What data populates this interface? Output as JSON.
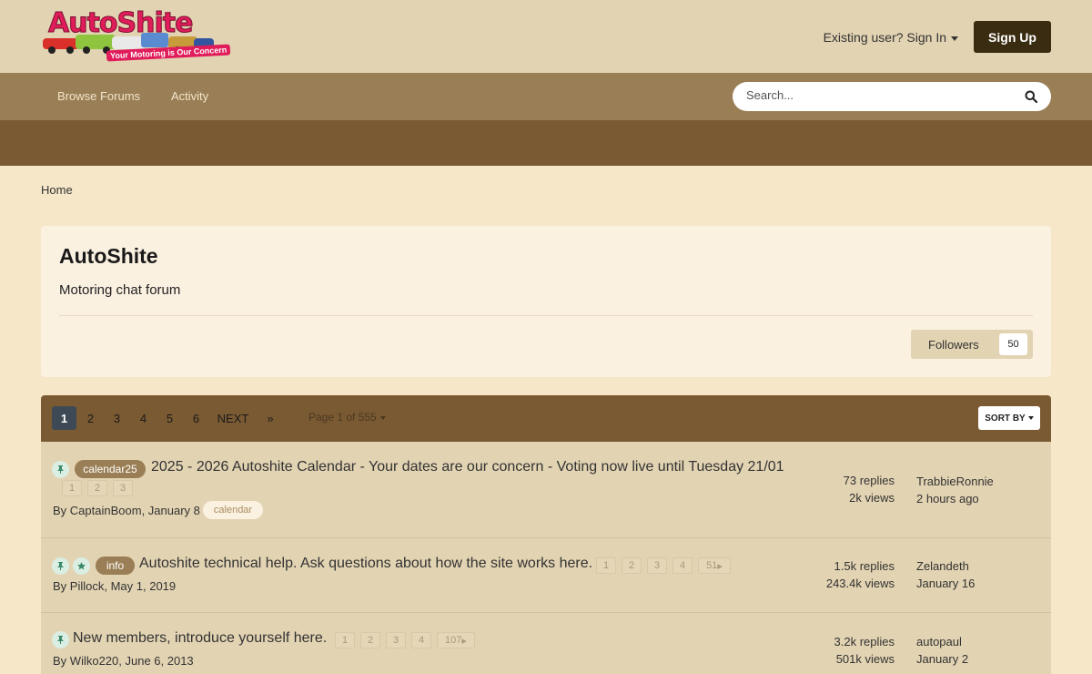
{
  "header": {
    "logo_text": "AutoShite",
    "logo_tagline": "Your Motoring is Our Concern",
    "signin_label": "Existing user? Sign In",
    "signup_label": "Sign Up"
  },
  "nav": {
    "items": [
      {
        "label": "Browse Forums"
      },
      {
        "label": "Activity"
      }
    ],
    "search_placeholder": "Search..."
  },
  "breadcrumb": {
    "home": "Home"
  },
  "forum": {
    "title": "AutoShite",
    "description": "Motoring chat forum",
    "followers_label": "Followers",
    "followers_count": "50"
  },
  "pagination": {
    "pages": [
      "1",
      "2",
      "3",
      "4",
      "5",
      "6"
    ],
    "next_label": "NEXT",
    "last_label": "»",
    "page_info": "Page 1 of 555",
    "sort_label": "SORT BY"
  },
  "topics": [
    {
      "tag": "calendar25",
      "title": "2025 - 2026 Autoshite Calendar - Your dates are our concern - Voting now live until Tuesday 21/01",
      "mini_pages": [
        "1",
        "2",
        "3"
      ],
      "author_prefix": "By ",
      "author": "CaptainBoom",
      "date": ", January 8",
      "extra_tag": "calendar",
      "replies": "73 replies",
      "views": "2k views",
      "last_user": "TrabbieRonnie",
      "last_time": "2 hours ago"
    },
    {
      "tag": "info",
      "title": "Autoshite technical help. Ask questions about how the site works here.",
      "mini_pages": [
        "1",
        "2",
        "3",
        "4",
        "51"
      ],
      "author_prefix": "By ",
      "author": "Pillock",
      "date": ", May 1, 2019",
      "replies": "1.5k replies",
      "views": "243.4k views",
      "last_user": "Zelandeth",
      "last_time": "January 16"
    },
    {
      "title": "New members, introduce yourself here.",
      "mini_pages": [
        "1",
        "2",
        "3",
        "4",
        "107"
      ],
      "author_prefix": "By ",
      "author": "Wilko220",
      "date": ", June 6, 2013",
      "replies": "3.2k replies",
      "views": "501k views",
      "last_user": "autopaul",
      "last_time": "January 2"
    }
  ],
  "colors": {
    "header_bg": "#e2d3b2",
    "nav_bg": "#9a7e55",
    "subbar_bg": "#7a5a33",
    "page_bg": "#f6e7c8",
    "signup_bg": "#3a2c10",
    "active_page": "#3d4a55"
  }
}
